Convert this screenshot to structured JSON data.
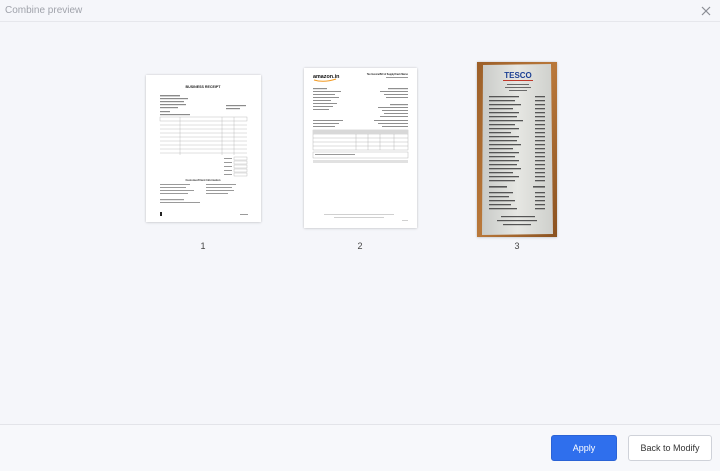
{
  "window": {
    "title": "Combine preview",
    "close_icon": "close-icon"
  },
  "pages": [
    {
      "number": "1",
      "thumbnail_title": "BUSINESS RECEIPT",
      "thumbnail_subtitle": "Customer/Client Information"
    },
    {
      "number": "2",
      "thumbnail_brand": "amazon.in",
      "thumbnail_title": "Tax Invoice/Bill of Supply/Cash Memo"
    },
    {
      "number": "3",
      "thumbnail_brand": "TESCO"
    }
  ],
  "footer": {
    "apply_label": "Apply",
    "back_label": "Back to Modify"
  },
  "colors": {
    "accent": "#2f6fed",
    "amazon_orange": "#f29a22",
    "tesco_blue": "#1b3f93"
  }
}
